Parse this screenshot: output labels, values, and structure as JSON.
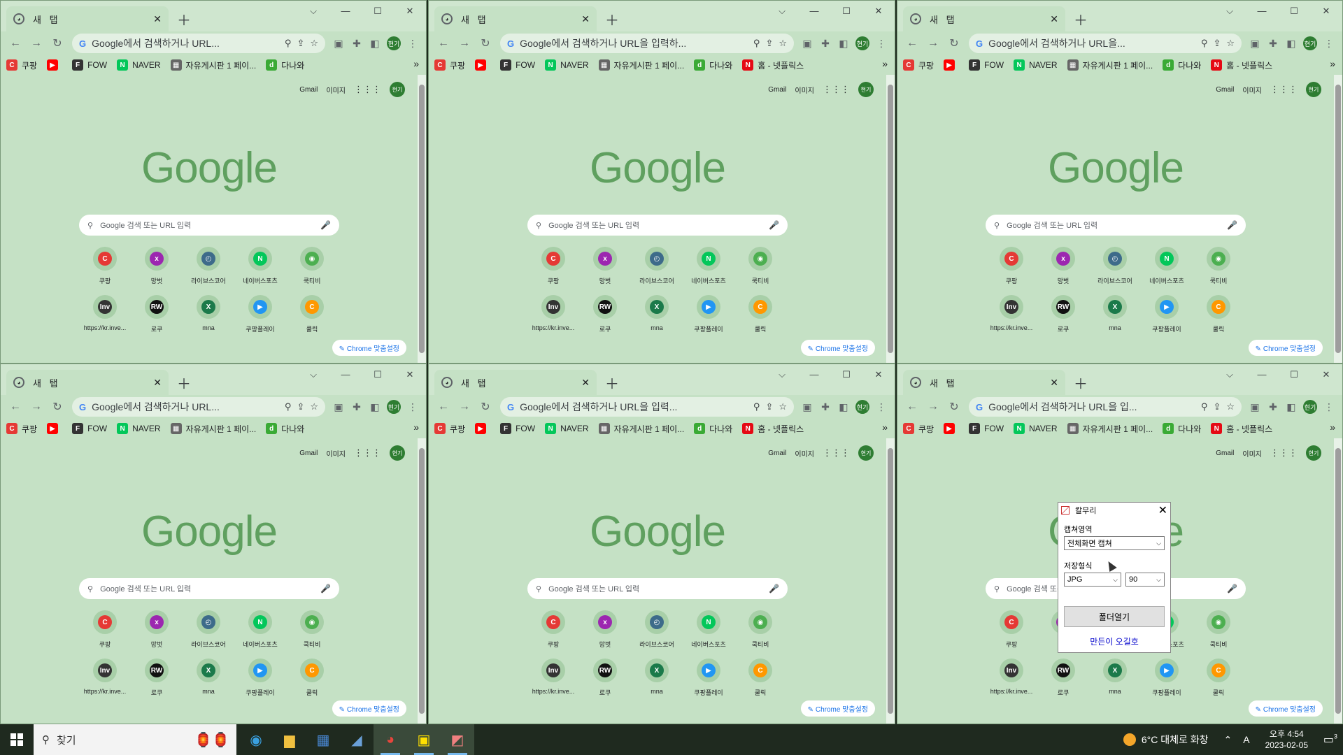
{
  "tab_title": "새 탭",
  "omnibox_texts": [
    "Google에서 검색하거나 URL...",
    "Google에서 검색하거나 URL을 입력하...",
    "Google에서 검색하거나 URL을...",
    "Google에서 검색하거나 URL...",
    "Google에서 검색하거나 URL을 입력...",
    "Google에서 검색하거나 URL을 입..."
  ],
  "profile_label": "현기",
  "bookmarks": [
    {
      "label": "쿠팡",
      "icon": "C",
      "color": "#e53935"
    },
    {
      "label": "",
      "icon": "▶",
      "color": "#ff0000"
    },
    {
      "label": "FOW",
      "icon": "F",
      "color": "#333333"
    },
    {
      "label": "NAVER",
      "icon": "N",
      "color": "#03c75a"
    },
    {
      "label": "자유게시판 1 페이...",
      "icon": "▦",
      "color": "#666666"
    },
    {
      "label": "다나와",
      "icon": "d",
      "color": "#3aaa35"
    },
    {
      "label": "홈 - 넷플릭스",
      "icon": "N",
      "color": "#e50914"
    }
  ],
  "top_links": {
    "gmail": "Gmail",
    "images": "이미지"
  },
  "logo": "Google",
  "search_placeholder": "Google 검색 또는 URL 입력",
  "shortcuts": [
    {
      "label": "쿠팡",
      "icon": "C",
      "color": "#e53935"
    },
    {
      "label": "망벗",
      "icon": "x",
      "color": "#9c27b0"
    },
    {
      "label": "라이브스코어",
      "icon": "◴",
      "color": "#3d6b8a"
    },
    {
      "label": "네이버스포츠",
      "icon": "N",
      "color": "#03c75a"
    },
    {
      "label": "쿡티비",
      "icon": "◉",
      "color": "#4caf50"
    },
    {
      "label": "https://kr.inve...",
      "icon": "Inv",
      "color": "#333333"
    },
    {
      "label": "로쿠",
      "icon": "RW",
      "color": "#111111"
    },
    {
      "label": "mna",
      "icon": "X",
      "color": "#1b7a4a"
    },
    {
      "label": "쿠팡플레이",
      "icon": "▶",
      "color": "#2196f3"
    },
    {
      "label": "쿨릭",
      "icon": "C",
      "color": "#ff9800"
    }
  ],
  "customize_label": "Chrome 맞춤설정",
  "capture_dialog": {
    "title": "칼무리",
    "area_label": "캡쳐영역",
    "area_value": "전체화면 캡쳐",
    "format_label": "저장형식",
    "format_value": "JPG",
    "quality_value": "90",
    "open_folder": "폴더열기",
    "credit_link": "만든이 오길호"
  },
  "taskbar": {
    "search_placeholder": "찾기",
    "weather": "6°C  대체로 화창",
    "ime": "A",
    "time": "오후 4:54",
    "date": "2023-02-05",
    "notification_count": "3"
  }
}
